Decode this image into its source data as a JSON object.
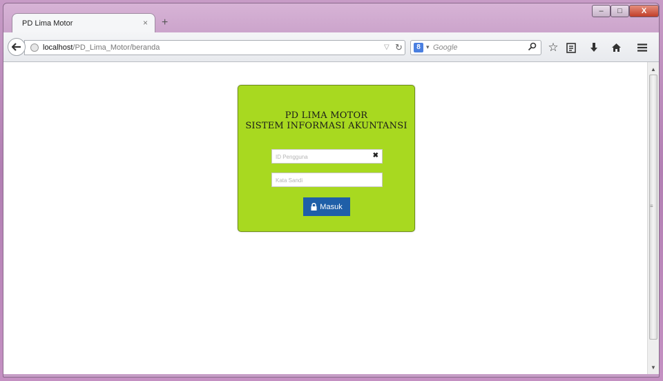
{
  "window": {
    "controls": {
      "minimize": "–",
      "maximize": "□",
      "close": "X"
    }
  },
  "tab": {
    "title": "PD Lima Motor",
    "close": "×",
    "new_tab": "+"
  },
  "navbar": {
    "url_host": "localhost",
    "url_path": "/PD_Lima_Motor/beranda",
    "search_placeholder": "Google",
    "search_engine_letter": "8"
  },
  "toolbar_icons": [
    "search-go-icon",
    "bookmark-star-icon",
    "reading-list-icon",
    "download-icon",
    "home-icon",
    "menu-icon"
  ],
  "login": {
    "title_line1": "PD LIMA MOTOR",
    "title_line2": "SISTEM INFORMASI AKUNTANSI",
    "username_placeholder": "ID Pengguna",
    "password_placeholder": "Kata Sandi",
    "submit_label": "Masuk"
  },
  "colors": {
    "card_bg": "#a8d920",
    "button_bg": "#1f5fa8"
  }
}
